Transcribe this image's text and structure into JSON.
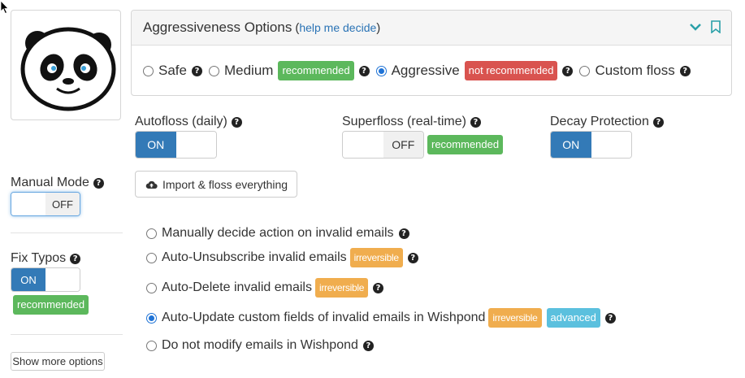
{
  "aggressiveness": {
    "title": "Aggressiveness Options",
    "paren_open": "(",
    "help_link": "help me decide",
    "paren_close": ")",
    "options": [
      {
        "label": "Safe",
        "selected": false
      },
      {
        "label": "Medium",
        "selected": false,
        "badge": "recommended"
      },
      {
        "label": "Aggressive",
        "selected": true,
        "badge": "not recommended"
      },
      {
        "label": "Custom floss",
        "selected": false
      }
    ]
  },
  "autofloss": {
    "label": "Autofloss (daily)",
    "state": "ON"
  },
  "superfloss": {
    "label": "Superfloss (real-time)",
    "state": "OFF",
    "badge": "recommended"
  },
  "decay": {
    "label": "Decay Protection",
    "state": "ON"
  },
  "import_button": {
    "label": "Import & floss everything"
  },
  "manual_mode": {
    "label": "Manual Mode",
    "state": "OFF"
  },
  "fix_typos": {
    "label": "Fix Typos",
    "state": "ON",
    "badge": "recommended"
  },
  "show_more": {
    "label": "Show more options"
  },
  "invalid_options": [
    {
      "label": "Manually decide action on invalid emails",
      "selected": false
    },
    {
      "label": "Auto-Unsubscribe invalid emails",
      "selected": false,
      "badge": "irreversible"
    },
    {
      "label": "Auto-Delete invalid emails",
      "selected": false,
      "badge": "irreversible"
    },
    {
      "label": "Auto-Update custom fields of invalid emails in Wishpond",
      "selected": true,
      "badge": "irreversible",
      "badge2": "advanced"
    },
    {
      "label": "Do not modify emails in Wishpond",
      "selected": false
    }
  ],
  "colors": {
    "primary": "#337ab7",
    "green": "#5cb85c",
    "red": "#d9534f",
    "orange": "#f0ad4e",
    "blue": "#5bc0de"
  },
  "icons": [
    "panda-logo",
    "chevron-down-icon",
    "bookmark-icon",
    "question-circle-icon",
    "cloud-upload-icon",
    "mouse-cursor-icon"
  ]
}
